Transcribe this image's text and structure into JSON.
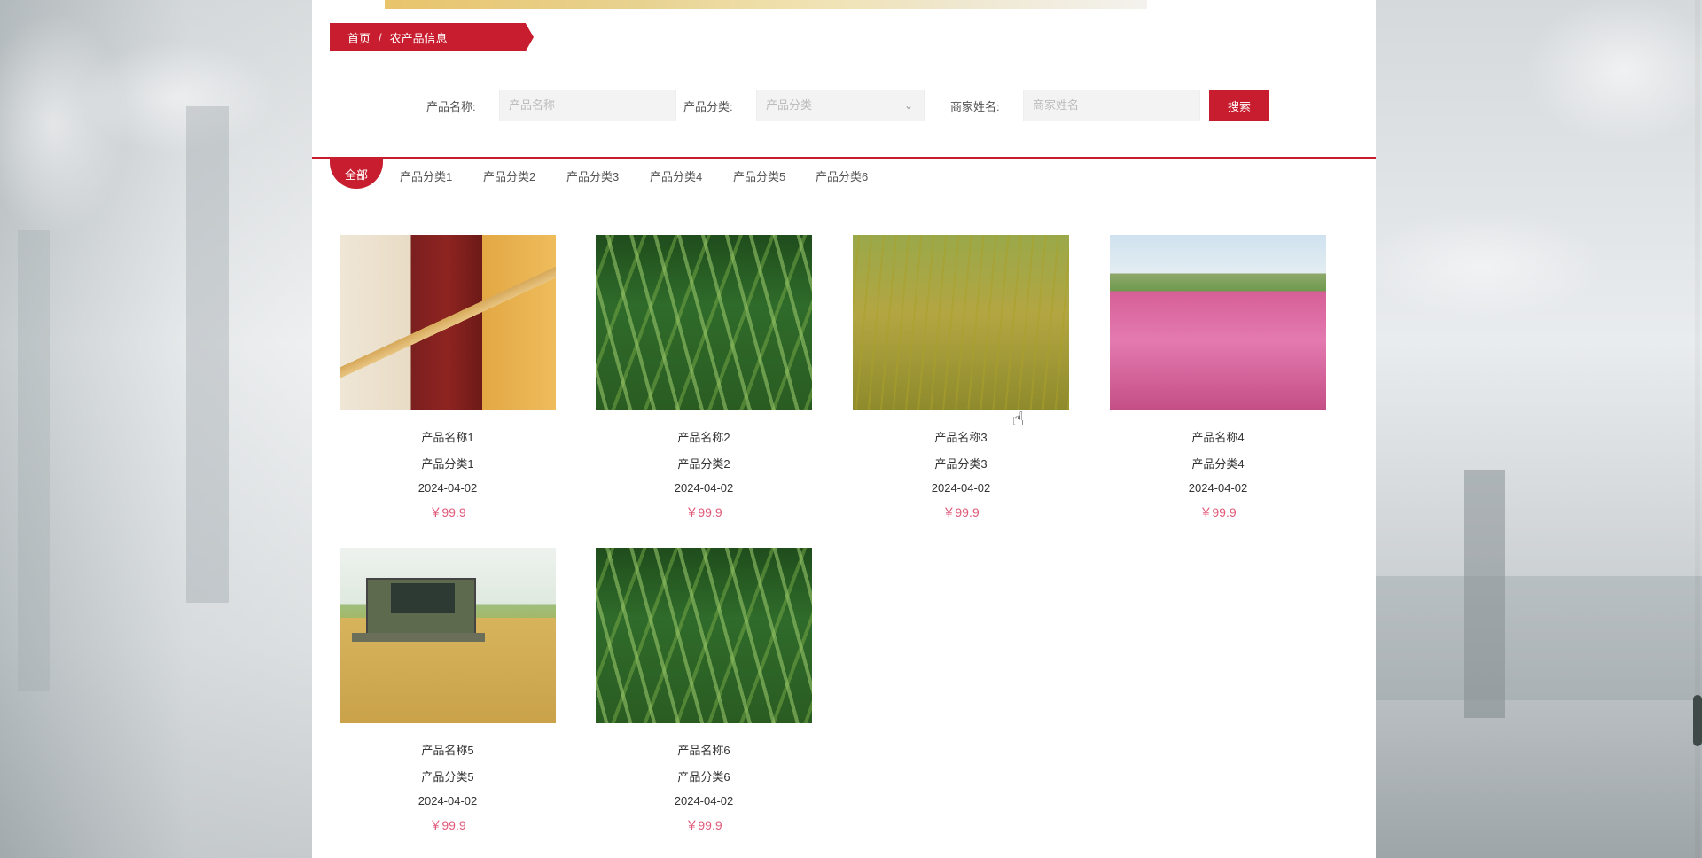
{
  "breadcrumb": {
    "home": "首页",
    "separator": "/",
    "current": "农产品信息"
  },
  "search": {
    "product_name_label": "产品名称:",
    "product_name_placeholder": "产品名称",
    "category_label": "产品分类:",
    "category_placeholder": "产品分类",
    "merchant_label": "商家姓名:",
    "merchant_placeholder": "商家姓名",
    "button_label": "搜索"
  },
  "tabs": [
    "全部",
    "产品分类1",
    "产品分类2",
    "产品分类3",
    "产品分类4",
    "产品分类5",
    "产品分类6"
  ],
  "products": [
    {
      "name": "产品名称1",
      "category": "产品分类1",
      "date": "2024-04-02",
      "price": "￥99.9",
      "image": "beans-grains"
    },
    {
      "name": "产品名称2",
      "category": "产品分类2",
      "date": "2024-04-02",
      "price": "￥99.9",
      "image": "green-rice-plants"
    },
    {
      "name": "产品名称3",
      "category": "产品分类3",
      "date": "2024-04-02",
      "price": "￥99.9",
      "image": "rice-paddy"
    },
    {
      "name": "产品名称4",
      "category": "产品分类4",
      "date": "2024-04-02",
      "price": "￥99.9",
      "image": "pink-flower-field"
    },
    {
      "name": "产品名称5",
      "category": "产品分类5",
      "date": "2024-04-02",
      "price": "￥99.9",
      "image": "combine-harvester"
    },
    {
      "name": "产品名称6",
      "category": "产品分类6",
      "date": "2024-04-02",
      "price": "￥99.9",
      "image": "green-rice-plants"
    }
  ],
  "colors": {
    "accent": "#c81d2e",
    "price": "#e05a7a"
  }
}
